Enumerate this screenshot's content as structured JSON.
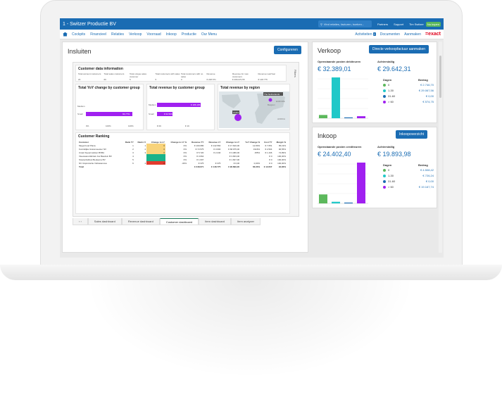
{
  "window": {
    "title": "1 - Switzer Productie BV"
  },
  "topbar": {
    "search_placeholder": "Vind relaties, facturen, boeken...",
    "links": [
      "Partners",
      "Support",
      "Tim Switzer"
    ],
    "badge": "Nu kopen"
  },
  "nav": {
    "items": [
      "Cockpits",
      "Financieel",
      "Relaties",
      "Verkoop",
      "Voorraad",
      "Inkoop",
      "Productie",
      "Our Menu"
    ],
    "right": {
      "activities": "Activiteiten",
      "activities_count": "2",
      "documents": "Documenten",
      "add": "Aanmaken",
      "brand": "=exact"
    }
  },
  "left": {
    "title": "Insluiten",
    "configure_button": "Configureren",
    "filters_label": "Filters",
    "customer_info": {
      "title": "Customer data information",
      "headers": [
        "Total account customers",
        "Total sales customers",
        "Total unique sales customer",
        "Total customers with sales",
        "Total customers with no sales",
        "Revenue",
        "Revenue for new customers",
        "Revenue LastYear"
      ],
      "values": [
        "20",
        "66",
        "5",
        "5",
        "0",
        "€ 248.671",
        "€ 296.070,55",
        "€ 148.775"
      ]
    },
    "yoy": {
      "title": "Total YoY change by customer group",
      "rows": [
        "Medium",
        "Small"
      ],
      "value": "66,77%",
      "ticks": [
        "0%",
        "100%",
        "100%"
      ]
    },
    "rev_group": {
      "title": "Total revenue by customer group",
      "rows": [
        "Medium",
        "Small"
      ],
      "values": [
        "€ 186.165",
        "€ 62.506"
      ],
      "ticks": [
        "€ 0K",
        "€ 1K"
      ]
    },
    "rev_region": {
      "title": "Total revenue by region",
      "labels": [
        "The Netherlands",
        "EUROPE",
        "Belgium",
        "Aruba",
        "AFRICA"
      ]
    },
    "ranking": {
      "title": "Customer Ranking",
      "headers": [
        "Customer",
        "Rank TY",
        "Rank LY",
        "Change to LY",
        "Change to LY %",
        "Revenue TY",
        "Revenue LY",
        "Change to LY",
        "YoY Change %",
        "Cost TY",
        "Margin %"
      ],
      "rows": [
        [
          "Mega Food Plaza",
          "1",
          "1",
          "0",
          "0%",
          "€ 100.080",
          "€ 142.560",
          "€ 17.620,00",
          "12,50%",
          "€ 7.651",
          "95,19%"
        ],
        [
          "Koninklijke Grassmeester NV",
          "2",
          "2",
          "0",
          "0%",
          "€ 72.575",
          "€ 3.600",
          "€ 68.975,00",
          "1916%",
          "€ 2.504",
          "96,55%"
        ],
        [
          "Uniek Supermarkten BVBA",
          "3",
          "3",
          "0",
          "0%",
          "€ 5.720",
          "€ 2.240",
          "€ 3.480,00",
          "155%",
          "€ 1.436",
          "74,89%"
        ],
        [
          "Vleeswarenfabriek Jos Baudoin BV",
          "4",
          "",
          "",
          "0%",
          "€ 3.664",
          "",
          "€ 3.663,00",
          "",
          "€ 0",
          "100,00%"
        ],
        [
          "Stoutenfabriek Beukema BV",
          "5",
          "",
          "",
          "0%",
          "€ 1.607",
          "",
          "€ 1.607,00",
          "",
          "€ 0",
          "100,00%"
        ],
        [
          "NV IJsproductie Vollcasanova",
          "6",
          "4",
          "-2",
          "-33%",
          "€ 375",
          "€ 375",
          "€ 0,00",
          "0,00%",
          "€ 0",
          "100,00%"
        ]
      ],
      "total": [
        "Total",
        "",
        "",
        "",
        "",
        "€ 248.671",
        "€ 148.775",
        "€ 96.899,00",
        "66,03%",
        "€ 12.847",
        "94,83%"
      ]
    },
    "tabs": [
      "Sales dashboard",
      "Revenue dashboard",
      "Customer dashboard",
      "Item dashboard",
      "Item analyzer"
    ],
    "active_tab": "Customer dashboard"
  },
  "verkoop": {
    "title": "Verkoop",
    "button": "Directe verkoopfactuur aanmaken",
    "open_label": "Openstaande posten debiteuren",
    "open_value": "€ 32.389,01",
    "arrears_label": "Achterstallig",
    "arrears_value": "€ 29.642,31",
    "days_header": "Dagen",
    "amount_header": "Bedrag",
    "legend": [
      {
        "label": "0",
        "amount": "€ 2.746,70",
        "color": "#5cb85c"
      },
      {
        "label": "1-30",
        "amount": "€ 29.067,56",
        "color": "#20c8c8"
      },
      {
        "label": "31-60",
        "amount": "€ 0,00",
        "color": "#1a6cb3"
      },
      {
        "label": "> 60",
        "amount": "€ 574,75",
        "color": "#a020f0"
      }
    ],
    "bars": [
      0.08,
      1.0,
      0.02,
      0.05
    ]
  },
  "inkoop": {
    "title": "Inkoop",
    "button": "Inkoopoverzicht",
    "open_label": "Openstaande posten crediteuren",
    "open_value": "€ 24.402,40",
    "arrears_label": "Achterstallig",
    "arrears_value": "€ 19.893,98",
    "days_header": "Dagen",
    "amount_header": "Bedrag",
    "legend": [
      {
        "label": "0",
        "amount": "€ 4.508,42",
        "color": "#5cb85c"
      },
      {
        "label": "1-30",
        "amount": "€ 726,24",
        "color": "#20c8c8"
      },
      {
        "label": "31-60",
        "amount": "€ 0,00",
        "color": "#1a6cb3"
      },
      {
        "label": "> 60",
        "amount": "€ 19.167,74",
        "color": "#a020f0"
      }
    ],
    "bars": [
      0.22,
      0.04,
      0.02,
      1.0
    ]
  }
}
